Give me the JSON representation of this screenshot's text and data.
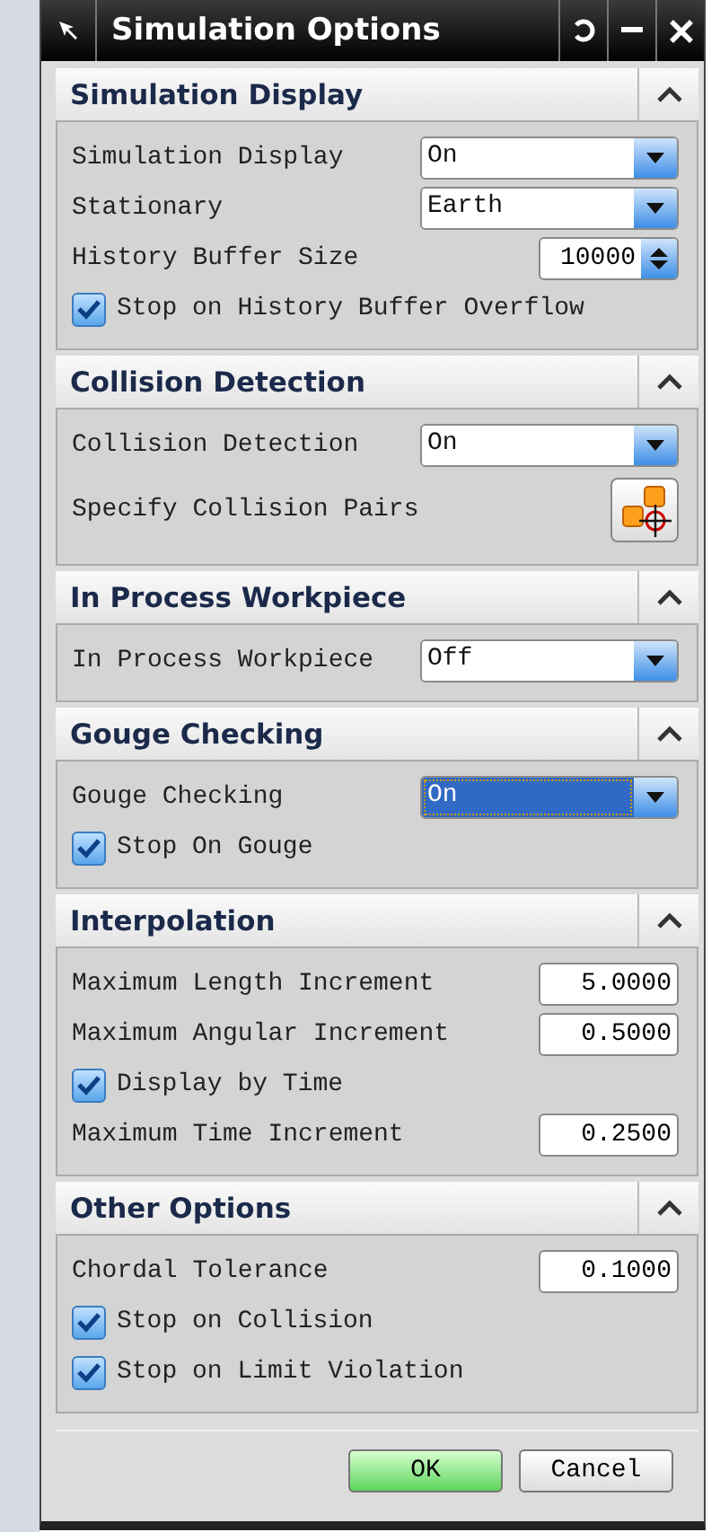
{
  "window": {
    "title": "Simulation Options"
  },
  "sections": [
    {
      "title": "Simulation Display",
      "expanded": true,
      "rows": [
        {
          "kind": "dropdown",
          "label": "Simulation Display",
          "value": "On",
          "focused": false
        },
        {
          "kind": "dropdown",
          "label": "Stationary",
          "value": "Earth",
          "focused": false
        },
        {
          "kind": "spinner",
          "label": "History Buffer Size",
          "value": "10000"
        },
        {
          "kind": "checkbox",
          "label": "Stop on History Buffer Overflow",
          "checked": true
        }
      ]
    },
    {
      "title": "Collision Detection",
      "expanded": true,
      "rows": [
        {
          "kind": "dropdown",
          "label": "Collision Detection",
          "value": "On",
          "focused": false
        },
        {
          "kind": "tool",
          "label": "Specify Collision Pairs"
        }
      ]
    },
    {
      "title": "In Process Workpiece",
      "expanded": true,
      "rows": [
        {
          "kind": "dropdown",
          "label": "In Process Workpiece",
          "value": "Off",
          "focused": false
        }
      ]
    },
    {
      "title": "Gouge Checking",
      "expanded": true,
      "rows": [
        {
          "kind": "dropdown",
          "label": "Gouge Checking",
          "value": "On",
          "focused": true
        },
        {
          "kind": "checkbox",
          "label": "Stop On Gouge",
          "checked": true
        }
      ]
    },
    {
      "title": "Interpolation",
      "expanded": true,
      "rows": [
        {
          "kind": "number",
          "label": "Maximum Length Increment",
          "value": "5.0000"
        },
        {
          "kind": "number",
          "label": "Maximum Angular Increment",
          "value": "0.5000"
        },
        {
          "kind": "checkbox",
          "label": "Display by Time",
          "checked": true
        },
        {
          "kind": "number",
          "label": "Maximum Time Increment",
          "value": "0.2500"
        }
      ]
    },
    {
      "title": "Other Options",
      "expanded": true,
      "rows": [
        {
          "kind": "number",
          "label": "Chordal Tolerance",
          "value": "0.1000"
        },
        {
          "kind": "checkbox",
          "label": "Stop on Collision",
          "checked": true
        },
        {
          "kind": "checkbox",
          "label": "Stop on Limit Violation",
          "checked": true
        }
      ]
    }
  ],
  "buttons": [
    {
      "label": "OK",
      "primary": true
    },
    {
      "label": "Cancel",
      "primary": false
    }
  ]
}
